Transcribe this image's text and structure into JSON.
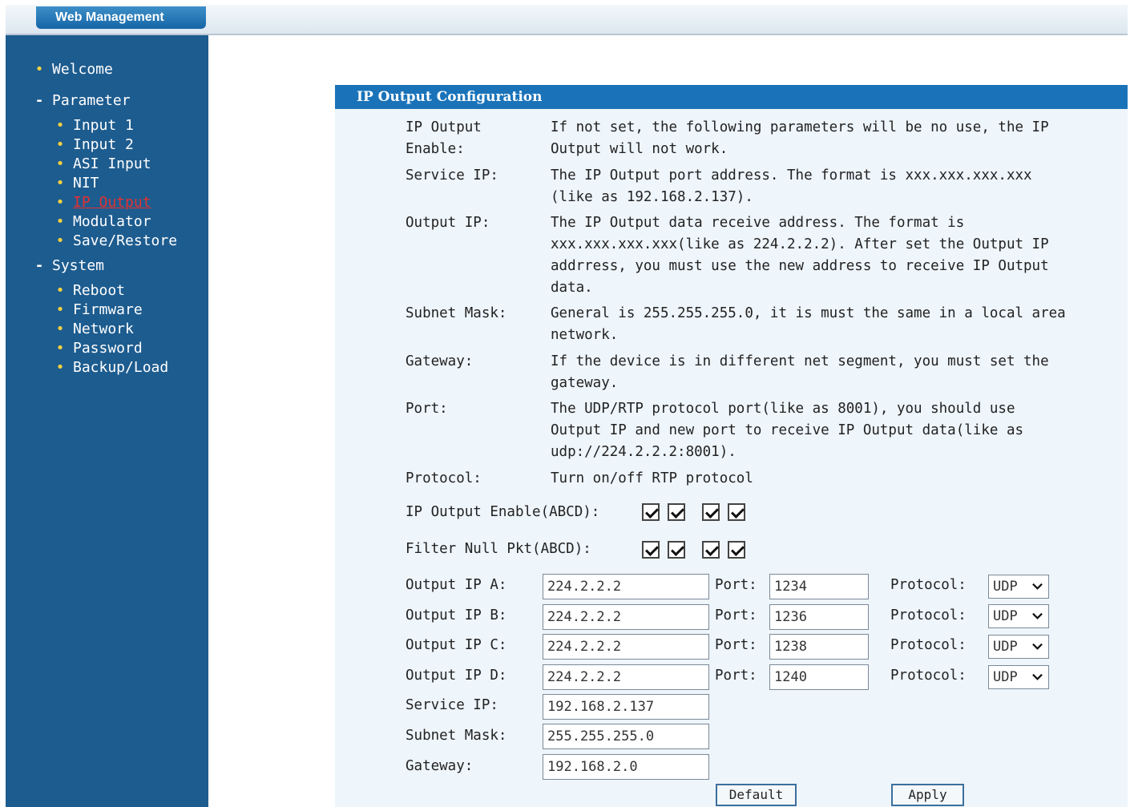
{
  "app_title": "Web Management",
  "sidebar": {
    "items": [
      {
        "label": "Welcome",
        "type": "bullet"
      },
      {
        "label": "Parameter",
        "type": "dash"
      },
      {
        "label": "Input 1",
        "type": "sub"
      },
      {
        "label": "Input 2",
        "type": "sub"
      },
      {
        "label": "ASI Input",
        "type": "sub"
      },
      {
        "label": "NIT",
        "type": "sub"
      },
      {
        "label": "IP Output",
        "type": "sub",
        "active": true
      },
      {
        "label": "Modulator",
        "type": "sub"
      },
      {
        "label": "Save/Restore",
        "type": "sub"
      },
      {
        "label": "System",
        "type": "dash"
      },
      {
        "label": "Reboot",
        "type": "sub"
      },
      {
        "label": "Firmware",
        "type": "sub"
      },
      {
        "label": "Network",
        "type": "sub"
      },
      {
        "label": "Password",
        "type": "sub"
      },
      {
        "label": "Backup/Load",
        "type": "sub"
      }
    ]
  },
  "panel": {
    "title": "IP Output Configuration",
    "help": [
      {
        "label": "IP Output Enable:",
        "text": "If not set, the following parameters will be no use, the IP Output will not work."
      },
      {
        "label": "Service IP:",
        "text": "The IP Output port address. The format is xxx.xxx.xxx.xxx (like as 192.168.2.137)."
      },
      {
        "label": "Output IP:",
        "text": "The IP Output data receive address. The format is xxx.xxx.xxx.xxx(like as 224.2.2.2). After set the Output IP addrress, you must use the new address to receive IP Output data."
      },
      {
        "label": "Subnet Mask:",
        "text": "General is 255.255.255.0, it is must the same in a local area network."
      },
      {
        "label": "Gateway:",
        "text": "If the device is in different net segment, you must set the gateway."
      },
      {
        "label": "Port:",
        "text": "The UDP/RTP protocol port(like as 8001), you should use Output IP and new port to receive IP Output data(like as udp://224.2.2.2:8001)."
      },
      {
        "label": "Protocol:",
        "text": "Turn on/off RTP protocol"
      }
    ],
    "enable_label": "IP Output Enable(ABCD):",
    "filter_label": "Filter Null Pkt(ABCD):",
    "port_label": "Port:",
    "protocol_label": "Protocol:",
    "outputs": [
      {
        "label": "Output IP A:",
        "ip": "224.2.2.2",
        "port": "1234",
        "protocol": "UDP"
      },
      {
        "label": "Output IP B:",
        "ip": "224.2.2.2",
        "port": "1236",
        "protocol": "UDP"
      },
      {
        "label": "Output IP C:",
        "ip": "224.2.2.2",
        "port": "1238",
        "protocol": "UDP"
      },
      {
        "label": "Output IP D:",
        "ip": "224.2.2.2",
        "port": "1240",
        "protocol": "UDP"
      }
    ],
    "service_ip_label": "Service IP:",
    "service_ip": "192.168.2.137",
    "subnet_label": "Subnet Mask:",
    "subnet": "255.255.255.0",
    "gateway_label": "Gateway:",
    "gateway": "192.168.2.0",
    "default_button": "Default",
    "apply_button": "Apply"
  }
}
